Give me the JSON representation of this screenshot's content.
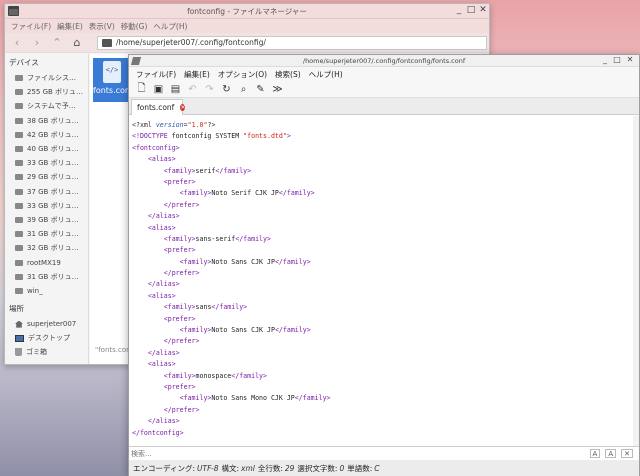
{
  "file_manager": {
    "title": "fontconfig - ファイルマネージャー",
    "window_controls": [
      "_",
      "□",
      "✕"
    ],
    "menu": [
      "ファイル(F)",
      "編集(E)",
      "表示(V)",
      "移動(G)",
      "ヘルプ(H)"
    ],
    "path": "/home/superjeter007/.config/fontconfig/",
    "devices_header": "デバイス",
    "devices": [
      "ファイルシス…",
      "255 GB ボリュ…",
      "システムで予…",
      "38 GB ボリュ…",
      "42 GB ボリュ…",
      "40 GB ボリュ…",
      "33 GB ボリュ…",
      "29 GB ボリュ…",
      "37 GB ボリュ…",
      "33 GB ボリュ…",
      "39 GB ボリュ…",
      "31 GB ボリュ…",
      "32 GB ボリュ…",
      "rootMX19",
      "31 GB ボリュ…",
      "win_"
    ],
    "places_header": "場所",
    "places": [
      "superjeter007",
      "デスクトップ",
      "ゴミ箱"
    ],
    "file_name": "fonts.conf",
    "status": "\"fonts.conf"
  },
  "editor": {
    "title": "/home/superjeter007/.config/fontconfig/fonts.conf",
    "menu": [
      "ファイル(F)",
      "編集(E)",
      "オプション(O)",
      "検索(S)",
      "ヘルプ(H)"
    ],
    "tab_label": "fonts.conf",
    "search_placeholder": "検索...",
    "search_buttons": [
      "A",
      "A",
      "✕"
    ],
    "status": {
      "encoding_label": "エンコーディング:",
      "encoding_value": "UTF-8",
      "syntax_label": "構文:",
      "syntax_value": "xml",
      "lines_label": "全行数:",
      "lines_value": "29",
      "selected_label": "選択文字数:",
      "selected_value": "0",
      "words_label": "単語数:",
      "words_value": "C"
    },
    "code": {
      "xml_decl_open": "<?xml ",
      "xml_decl_attr": "version",
      "xml_decl_eq": "=",
      "xml_decl_val": "\"1.0\"",
      "xml_decl_close": "?>",
      "doctype_open": "<!DOCTYPE ",
      "doctype_body": "fontconfig SYSTEM ",
      "doctype_val": "\"fonts.dtd\"",
      "doctype_close": ">",
      "fontconfig_open": "<fontconfig>",
      "fontconfig_close": "</fontconfig>",
      "alias_open": "<alias>",
      "alias_close": "</alias>",
      "family_open": "<family>",
      "family_close": "</family>",
      "prefer_open": "<prefer>",
      "prefer_close": "</prefer>",
      "aliases": [
        {
          "family": "serif",
          "prefer": "Noto Serif CJK JP"
        },
        {
          "family": "sans-serif",
          "prefer": "Noto Sans CJK JP"
        },
        {
          "family": "sans",
          "prefer": "Noto Sans CJK JP"
        },
        {
          "family": "monospace",
          "prefer": "Noto Sans Mono CJK JP"
        }
      ]
    }
  }
}
